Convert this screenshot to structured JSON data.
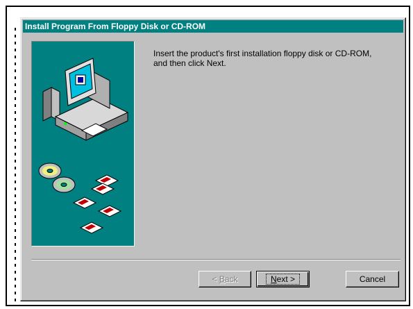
{
  "dialog": {
    "title": "Install Program From Floppy Disk or CD-ROM",
    "message_line1": "Insert the product's first installation floppy disk or CD-ROM,",
    "message_line2": "and then click Next."
  },
  "buttons": {
    "back": {
      "accel": "B",
      "rest": "ack",
      "prefix": "< "
    },
    "next": {
      "accel": "N",
      "rest": "ext",
      "suffix": " >"
    },
    "cancel": "Cancel"
  },
  "colors": {
    "title_bar": "#008080",
    "art_background": "#008080",
    "dialog_face": "#c0c0c0"
  },
  "illustration": {
    "icons": [
      "computer-icon",
      "cd-rom-disc-icon",
      "floppy-disk-icon"
    ]
  }
}
